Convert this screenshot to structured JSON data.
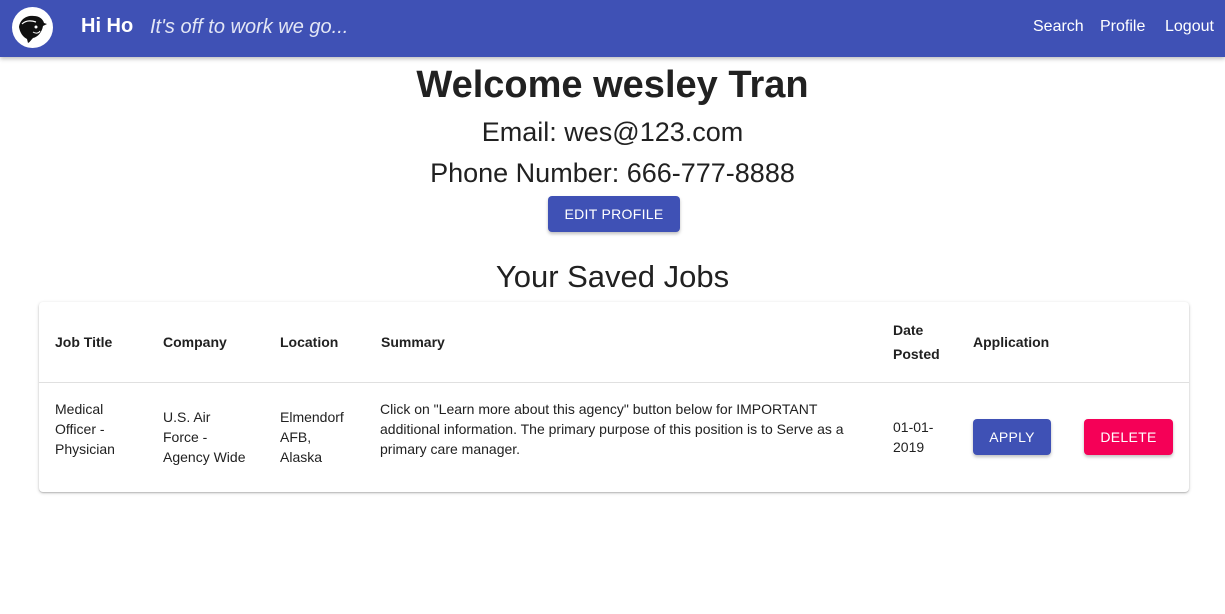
{
  "header": {
    "brand": "Hi Ho",
    "tagline": "It's off to work we go...",
    "nav": {
      "search": "Search",
      "profile": "Profile",
      "logout": "Logout"
    }
  },
  "profile": {
    "welcome": "Welcome wesley Tran",
    "email_line": "Email: wes@123.com",
    "phone_line": "Phone Number: 666-777-8888",
    "edit_button": "EDIT PROFILE"
  },
  "saved_jobs": {
    "heading": "Your Saved Jobs",
    "columns": {
      "job_title": "Job Title",
      "company": "Company",
      "location": "Location",
      "summary": "Summary",
      "date_posted_1": "Date",
      "date_posted_2": "Posted",
      "application": "Application"
    },
    "rows": [
      {
        "job_title": [
          "Medical",
          "Officer -",
          "Physician"
        ],
        "company": [
          "U.S. Air",
          "Force -",
          "Agency Wide"
        ],
        "location": [
          "Elmendorf",
          "AFB,",
          "Alaska"
        ],
        "summary": [
          "Click on \"Learn more about this agency\" button below for IMPORTANT",
          "additional information. The primary purpose of this position is to Serve as a",
          "primary care manager."
        ],
        "date_posted": [
          "01-01-",
          "2019"
        ],
        "apply_label": "APPLY",
        "delete_label": "DELETE"
      }
    ]
  },
  "colors": {
    "primary": "#3f51b5",
    "danger": "#f50057"
  },
  "icons": {
    "logo": "dwarf-logo-icon"
  }
}
